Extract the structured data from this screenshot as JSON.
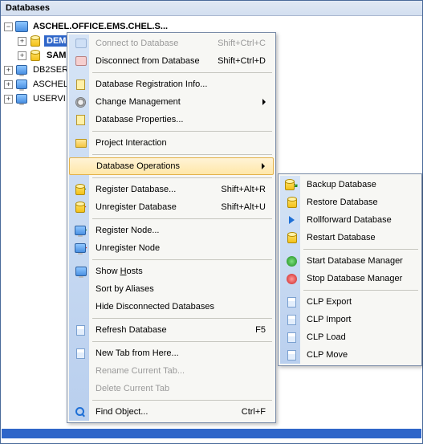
{
  "panel": {
    "title": "Databases"
  },
  "tree": {
    "root_label": "ASCHEL.OFFICE.EMS.CHEL.S...",
    "items": [
      {
        "label": "DEMODB",
        "selected": true
      },
      {
        "label": "SAM"
      }
    ],
    "siblings": [
      {
        "label": "DB2SER"
      },
      {
        "label": "ASCHEL"
      },
      {
        "label": "USERVI"
      }
    ]
  },
  "menu": {
    "items": [
      {
        "id": "connect",
        "label": "Connect to Database",
        "shortcut": "Shift+Ctrl+C",
        "disabled": true
      },
      {
        "id": "disconnect",
        "label": "Disconnect from Database",
        "shortcut": "Shift+Ctrl+D"
      },
      {
        "sep": true
      },
      {
        "id": "reginfo",
        "label": "Database Registration Info..."
      },
      {
        "id": "changemgmt",
        "label": "Change Management",
        "submenu": true
      },
      {
        "id": "props",
        "label": "Database Properties..."
      },
      {
        "sep": true
      },
      {
        "id": "projinter",
        "label": "Project Interaction"
      },
      {
        "sep": true
      },
      {
        "id": "dbops",
        "label": "Database Operations",
        "submenu": true,
        "highlight": true
      },
      {
        "sep": true
      },
      {
        "id": "regdb",
        "label": "Register Database...",
        "shortcut": "Shift+Alt+R"
      },
      {
        "id": "unregdb",
        "label": "Unregister Database",
        "shortcut": "Shift+Alt+U"
      },
      {
        "sep": true
      },
      {
        "id": "regnode",
        "label": "Register Node..."
      },
      {
        "id": "unregnode",
        "label": "Unregister Node"
      },
      {
        "sep": true
      },
      {
        "id": "showhosts",
        "label": "Show Hosts"
      },
      {
        "id": "sortalias",
        "label": "Sort by Aliases"
      },
      {
        "id": "hidedc",
        "label": "Hide Disconnected Databases"
      },
      {
        "sep": true
      },
      {
        "id": "refresh",
        "label": "Refresh Database",
        "shortcut": "F5"
      },
      {
        "sep": true
      },
      {
        "id": "newtab",
        "label": "New Tab from Here..."
      },
      {
        "id": "renametab",
        "label": "Rename Current Tab...",
        "disabled": true
      },
      {
        "id": "deletetab",
        "label": "Delete Current Tab",
        "disabled": true
      },
      {
        "sep": true
      },
      {
        "id": "findobj",
        "label": "Find Object...",
        "shortcut": "Ctrl+F"
      }
    ]
  },
  "submenu": {
    "items": [
      {
        "id": "backup",
        "label": "Backup Database"
      },
      {
        "id": "restore",
        "label": "Restore Database"
      },
      {
        "id": "rollfwd",
        "label": "Rollforward Database"
      },
      {
        "id": "restart",
        "label": "Restart Database"
      },
      {
        "sep": true
      },
      {
        "id": "startmgr",
        "label": "Start Database Manager"
      },
      {
        "id": "stopmgr",
        "label": "Stop Database Manager"
      },
      {
        "sep": true
      },
      {
        "id": "clpexport",
        "label": "CLP Export"
      },
      {
        "id": "clpimport",
        "label": "CLP Import"
      },
      {
        "id": "clpload",
        "label": "CLP Load"
      },
      {
        "id": "clpmove",
        "label": "CLP Move"
      }
    ]
  }
}
